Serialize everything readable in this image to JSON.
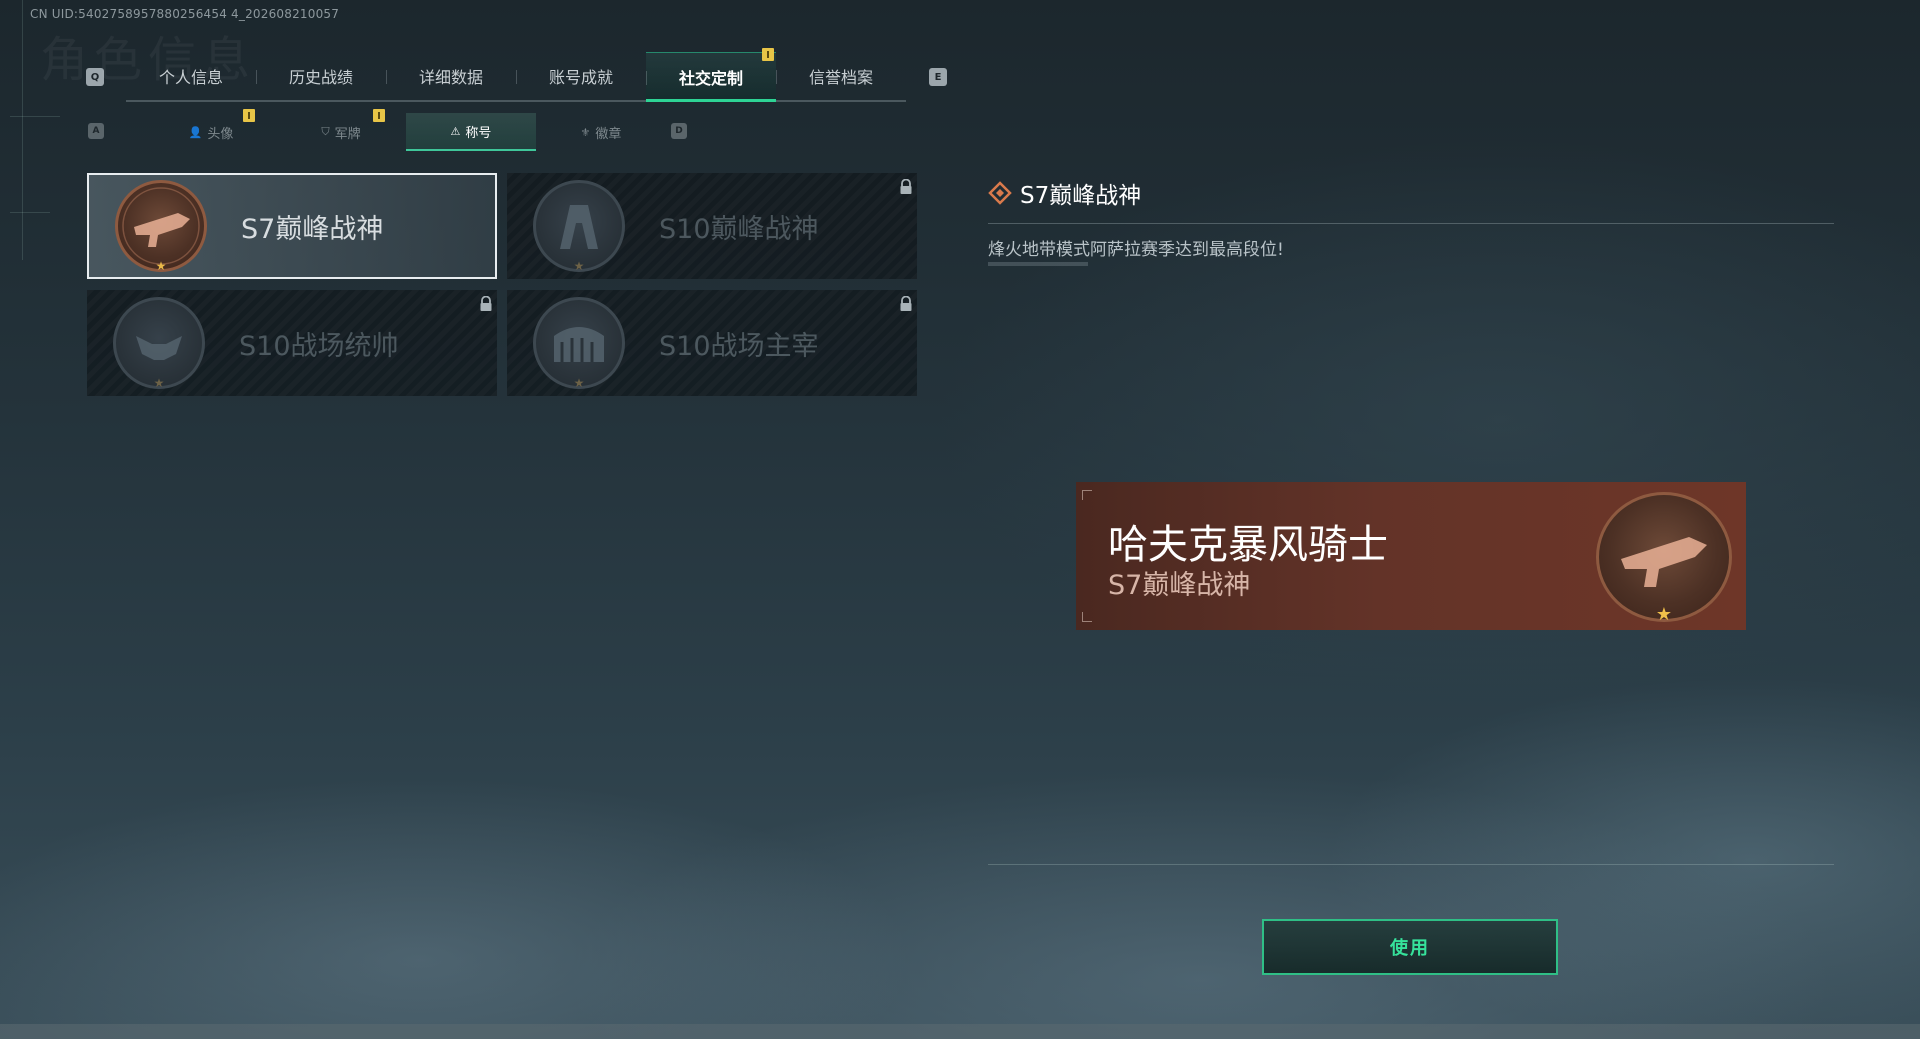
{
  "uid": "CN UID:5402758957880256454 4_202608210057",
  "header": {
    "ghost_title": "角色信息"
  },
  "hotkeys": {
    "prev_tab": "Q",
    "next_tab": "E",
    "prev_sub": "A",
    "next_sub": "D"
  },
  "tabs": [
    {
      "label": "个人信息"
    },
    {
      "label": "历史战绩"
    },
    {
      "label": "详细数据"
    },
    {
      "label": "账号成就"
    },
    {
      "label": "社交定制",
      "active": true
    },
    {
      "label": "信誉档案"
    }
  ],
  "subtabs": [
    {
      "label": "头像",
      "icon": "person-icon"
    },
    {
      "label": "军牌",
      "icon": "dogtag-icon"
    },
    {
      "label": "称号",
      "icon": "triangle-icon",
      "active": true
    },
    {
      "label": "徽章",
      "icon": "wing-icon"
    }
  ],
  "titles": [
    {
      "name": "S7巅峰战神",
      "selected": true,
      "locked": false
    },
    {
      "name": "S10巅峰战神",
      "selected": false,
      "locked": true
    },
    {
      "name": "S10战场统帅",
      "selected": false,
      "locked": true
    },
    {
      "name": "S10战场主宰",
      "selected": false,
      "locked": true
    }
  ],
  "detail": {
    "title": "S7巅峰战神",
    "description": "烽火地带模式阿萨拉赛季达到最高段位!"
  },
  "preview": {
    "player_name": "哈夫克暴风骑士",
    "title": "S7巅峰战神"
  },
  "actions": {
    "use_label": "使用"
  },
  "colors": {
    "accent": "#2ed495",
    "bronze": "#8e5a40",
    "preview_bg": "#633328"
  }
}
